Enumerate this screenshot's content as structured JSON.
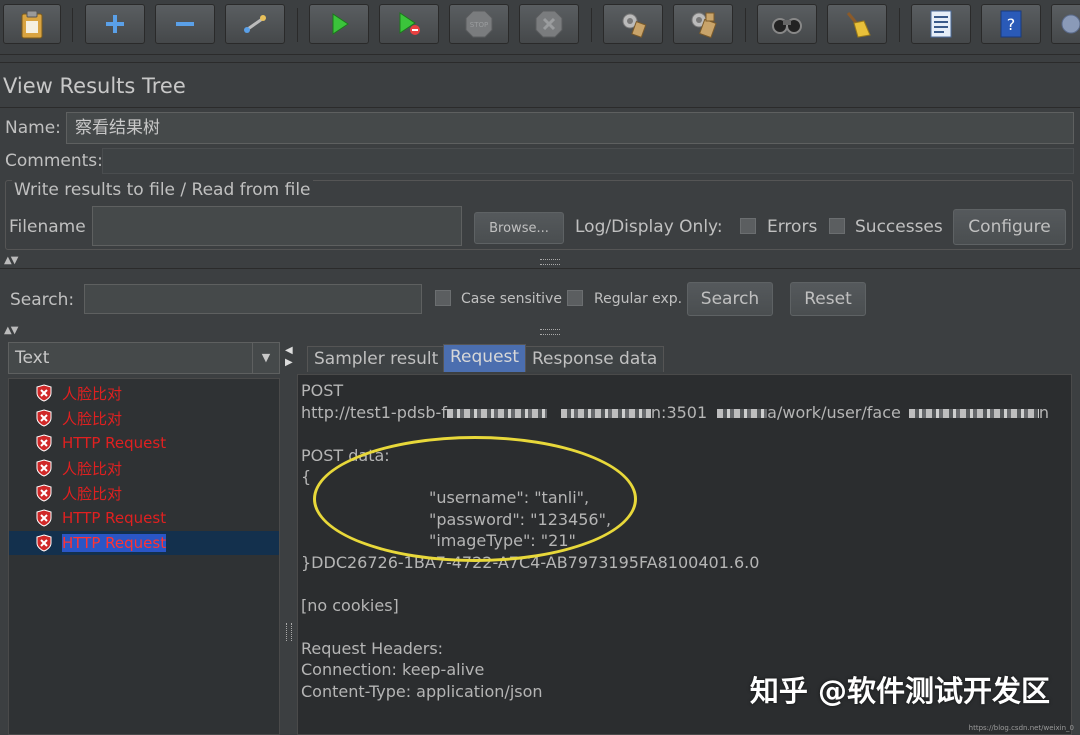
{
  "toolbar": {
    "buttons": [
      "clipboard-icon",
      "add-icon",
      "remove-icon",
      "toggle-icon",
      "start-icon",
      "start-no-pause-icon",
      "stop-icon",
      "shutdown-icon",
      "clear-icon",
      "clear-all-icon",
      "search-icon",
      "reset-search-icon",
      "function-helper-icon",
      "help-icon",
      "more-icon"
    ]
  },
  "panel": {
    "title": "View Results Tree",
    "name_label": "Name:",
    "name_value": "察看结果树",
    "comments_label": "Comments:"
  },
  "file_group": {
    "title": "Write results to file / Read from file",
    "filename_label": "Filename",
    "browse_label": "Browse...",
    "log_display_label": "Log/Display Only:",
    "errors_label": "Errors",
    "successes_label": "Successes",
    "configure_label": "Configure"
  },
  "search": {
    "label": "Search:",
    "case_sensitive_label": "Case sensitive",
    "regular_exp_label": "Regular exp.",
    "search_button": "Search",
    "reset_button": "Reset"
  },
  "renderer": {
    "selected": "Text"
  },
  "tree_items": [
    {
      "label": "人脸比对",
      "selected": false
    },
    {
      "label": "人脸比对",
      "selected": false
    },
    {
      "label": "HTTP Request",
      "selected": false
    },
    {
      "label": "人脸比对",
      "selected": false
    },
    {
      "label": "人脸比对",
      "selected": false
    },
    {
      "label": "HTTP Request",
      "selected": false
    },
    {
      "label": "HTTP Request",
      "selected": true
    }
  ],
  "tabs": [
    {
      "label": "Sampler result",
      "active": false
    },
    {
      "label": "Request",
      "active": true
    },
    {
      "label": "Response data",
      "active": false
    }
  ],
  "request": {
    "method": "POST",
    "url_part1": "http://test1-pdsb-f",
    "url_part2": "n:3501",
    "url_part3": "a/work/user/face",
    "url_part4": "n",
    "post_data_label": "POST data:",
    "brace_open": "{",
    "username_line": "\"username\": \"tanli\",",
    "password_line": "\"password\": \"123456\",",
    "imagetype_line": "\"imageType\": \"21\"",
    "closing_line": "}DDC26726-1BA7-4722-A7C4-AB7973195FA8100401.6.0",
    "cookies": "[no cookies]",
    "headers_label": "Request Headers:",
    "header_connection": "Connection: keep-alive",
    "header_content_type": "Content-Type: application/json"
  },
  "watermark": {
    "text": "知乎 @软件测试开发区",
    "small": "https://blog.csdn.net/weixin_0"
  },
  "colors": {
    "accent_tab": "#4b6eaf",
    "error_text": "#e02020",
    "highlight_circle": "#e8d83a"
  }
}
